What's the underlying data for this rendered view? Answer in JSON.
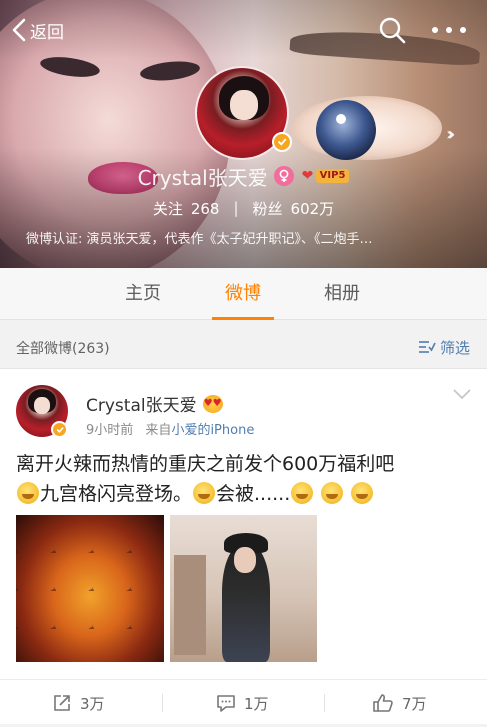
{
  "nav": {
    "back_label": "返回"
  },
  "profile": {
    "name": "Crystal张天爱",
    "vip_level": "VIP5",
    "following_label": "关注",
    "following_count": "268",
    "separator": "|",
    "followers_label": "粉丝",
    "followers_count": "602万",
    "verification": "微博认证: 演员张天爱，代表作《太子妃升职记》、《二炮手…"
  },
  "tabs": [
    {
      "label": "主页",
      "active": false
    },
    {
      "label": "微博",
      "active": true
    },
    {
      "label": "相册",
      "active": false
    }
  ],
  "filter": {
    "count_label": "全部微博(263)",
    "filter_label": "筛选"
  },
  "post": {
    "author": "Crystal张天爱",
    "time": "9小时前",
    "source_prefix": "来自",
    "source": "小爱的iPhone",
    "text_line1": "离开火辣而热情的重庆之前发个600万福利吧",
    "text_part2": "九宫格闪亮登场。",
    "text_part3": "会被......",
    "emoji_icons": [
      "grin-emoji",
      "thinking-emoji",
      "smirk-emoji",
      "smirk-emoji",
      "smirk-emoji"
    ],
    "images": [
      "hotpot-photo",
      "portrait-photo"
    ]
  },
  "actions": {
    "repost_count": "3万",
    "comment_count": "1万",
    "like_count": "7万"
  },
  "colors": {
    "accent": "#ff8200",
    "link": "#507daf"
  }
}
